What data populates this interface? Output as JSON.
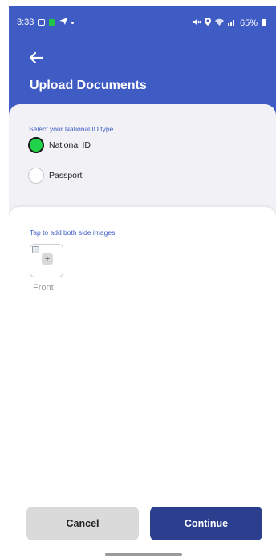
{
  "status_bar": {
    "time": "3:33",
    "icons_left": [
      "gallery-icon",
      "green-app-icon",
      "telegram-icon",
      "dot-icon"
    ],
    "icons_right": [
      "mute-icon",
      "location-icon",
      "wifi-icon",
      "signal-icon",
      "battery-icon"
    ],
    "battery_percent": "65%"
  },
  "header": {
    "back_icon": "arrow-left-icon",
    "title": "Upload Documents"
  },
  "id_type": {
    "label": "Select your National ID type",
    "options": [
      {
        "label": "National ID",
        "selected": true
      },
      {
        "label": "Passport",
        "selected": false
      }
    ]
  },
  "upload": {
    "instruction": "Tap to add both side images",
    "front_label": "Front",
    "front_icon": "plus-icon",
    "placeholder_icon": "broken-image-icon"
  },
  "actions": {
    "cancel_label": "Cancel",
    "continue_label": "Continue"
  },
  "colors": {
    "brand": "#3f5bc4",
    "continue_button": "#2c3f8f",
    "cancel_button": "#dadada",
    "selected_radio": "#20d34a"
  }
}
